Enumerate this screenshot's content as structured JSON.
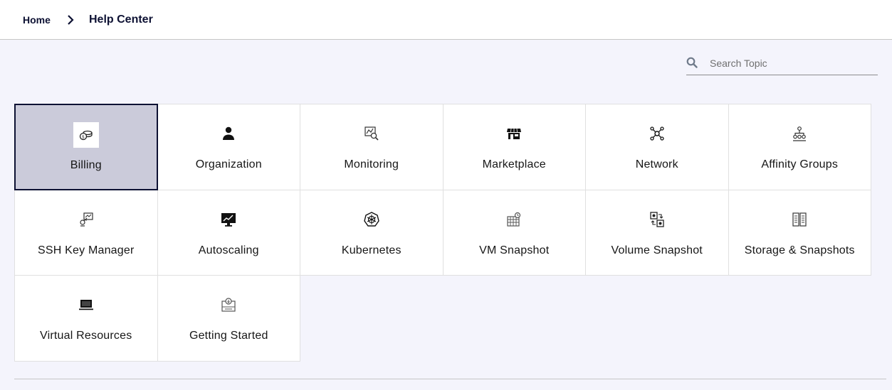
{
  "breadcrumb": {
    "home": "Home",
    "current": "Help Center"
  },
  "search": {
    "placeholder": "Search Topic",
    "value": ""
  },
  "topics": [
    {
      "label": "Billing",
      "icon": "billing-coins-icon",
      "active": true
    },
    {
      "label": "Organization",
      "icon": "user-icon",
      "active": false
    },
    {
      "label": "Monitoring",
      "icon": "monitoring-icon",
      "active": false
    },
    {
      "label": "Marketplace",
      "icon": "storefront-icon",
      "active": false
    },
    {
      "label": "Network",
      "icon": "network-icon",
      "active": false
    },
    {
      "label": "Affinity Groups",
      "icon": "hierarchy-icon",
      "active": false
    },
    {
      "label": "SSH Key Manager",
      "icon": "ssh-key-icon",
      "active": false
    },
    {
      "label": "Autoscaling",
      "icon": "monitor-chart-icon",
      "active": false
    },
    {
      "label": "Kubernetes",
      "icon": "kubernetes-icon",
      "active": false
    },
    {
      "label": "VM Snapshot",
      "icon": "vm-snapshot-icon",
      "active": false
    },
    {
      "label": "Volume Snapshot",
      "icon": "volume-snapshot-icon",
      "active": false
    },
    {
      "label": "Storage & Snapshots",
      "icon": "storage-icon",
      "active": false
    },
    {
      "label": "Virtual Resources",
      "icon": "laptop-icon",
      "active": false
    },
    {
      "label": "Getting Started",
      "icon": "getting-started-icon",
      "active": false
    }
  ],
  "colors": {
    "background": "#f4f4fc",
    "active_tile": "#cbcbda",
    "active_border": "#0d1133"
  }
}
